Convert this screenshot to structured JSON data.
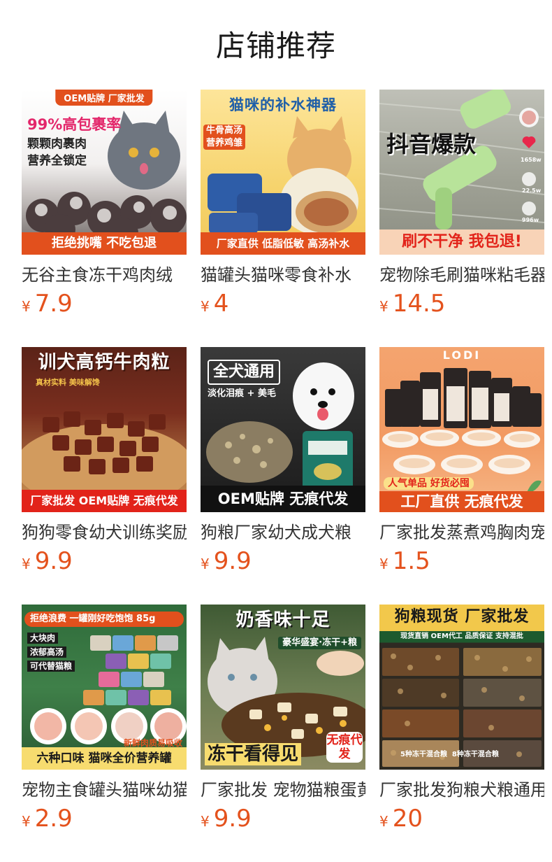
{
  "section": {
    "title": "店铺推荐"
  },
  "currency_symbol": "¥",
  "products": [
    {
      "title": "无谷主食冻干鸡肉绒",
      "price": "7.9",
      "image": {
        "badge": "OEM贴牌 厂家批发",
        "headline": "99%高包裹率",
        "lines": [
          "颗颗肉裹肉",
          "营养全锁定"
        ],
        "footer": "拒绝挑嘴 不吃包退",
        "bg": "#cfcbc9",
        "accent": "#e2501d"
      }
    },
    {
      "title": "猫罐头猫咪零食补水",
      "price": "4",
      "image": {
        "headline": "猫咪的补水神器",
        "lines": [
          "牛骨高汤",
          "营养鸡雏"
        ],
        "footer": "厂家直供 低脂低敏 高汤补水",
        "bg": "#f7d87a",
        "accent": "#e2501d"
      }
    },
    {
      "title": "宠物除毛刷猫咪粘毛器",
      "price": "14.5",
      "image": {
        "headline": "抖音爆款",
        "lines": [
          "1658w",
          "22.5w",
          "996w"
        ],
        "footer": "刷不干净 我包退!",
        "bg": "#a9ab9d",
        "accent": "#e2231a"
      }
    },
    {
      "title": "狗狗零食幼犬训练奖励",
      "price": "9.9",
      "image": {
        "headline": "训犬高钙牛肉粒",
        "lines": [
          "真材实料 美味解馋"
        ],
        "footer": "厂家批发 OEM贴牌 无痕代发",
        "bg": "#7a2e1e",
        "accent": "#e2501d"
      }
    },
    {
      "title": "狗粮厂家幼犬成犬粮",
      "price": "9.9",
      "image": {
        "headline": "全犬通用",
        "lines": [
          "淡化泪痕 + 美毛"
        ],
        "footer": "OEM贴牌 无痕代发",
        "bg": "#2b2b2b",
        "accent": "#111111"
      }
    },
    {
      "title": "厂家批发蒸煮鸡胸肉宠物",
      "price": "1.5",
      "image": {
        "headline": "LODI",
        "lines": [
          "人气单品 好货必囤"
        ],
        "footer": "工厂直供 无痕代发",
        "bg": "#f29a62",
        "accent": "#e2501d"
      }
    },
    {
      "title": "宠物主食罐头猫咪幼猫",
      "price": "2.9",
      "image": {
        "headline": "拒绝浪费 一罐刚好吃饱饱 85g",
        "lines": [
          "大块肉",
          "浓郁高汤",
          "可代替猫粮"
        ],
        "footer": "六种口味  猫咪全价营养罐",
        "side": "新鲜肉质易吸收",
        "bg": "#2f6b3a",
        "accent": "#e2501d"
      }
    },
    {
      "title": "厂家批发 宠物猫粮蛋黄",
      "price": "9.9",
      "image": {
        "headline": "奶香味十足",
        "lines": [
          "豪华盛宴·冻干+粮"
        ],
        "footer": "冻干看得见",
        "side": "无痕代发",
        "bg": "#6b7d52",
        "accent": "#1f4d2b"
      }
    },
    {
      "title": "厂家批发狗粮犬粮通用",
      "price": "20",
      "image": {
        "headline": "狗粮现货 厂家批发",
        "lines": [
          "现货直销 OEM代工 品质保证 支持混批"
        ],
        "footer": "5种冻干混合粮  8种冻干混合粮",
        "bg": "#3a3a2e",
        "accent": "#1d5a2e"
      }
    }
  ]
}
